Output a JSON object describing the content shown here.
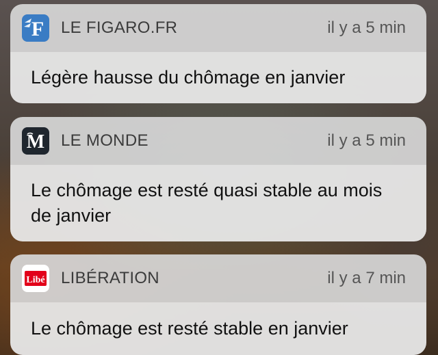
{
  "notifications": [
    {
      "app_name": "LE FIGARO.FR",
      "time": "il y a 5 min",
      "message": "Légère hausse du chômage en janvier",
      "icon": "le-figaro-logo-icon",
      "icon_color": "#3a7cc4",
      "icon_glyph": "F"
    },
    {
      "app_name": "LE MONDE",
      "time": "il y a 5 min",
      "message": "Le chômage est resté quasi stable au mois de janvier",
      "icon": "le-monde-logo-icon",
      "icon_color": "#1f262e",
      "icon_glyph": "M"
    },
    {
      "app_name": "LIBÉRATION",
      "time": "il y a 7 min",
      "message": "Le chômage est resté stable en janvier",
      "icon": "liberation-logo-icon",
      "icon_color": "#e2001a",
      "icon_glyph": "Libé"
    }
  ],
  "colors": {
    "header_bg": "#d6d6d6",
    "body_bg": "#e8e8e8",
    "liberation_red": "#e2001a"
  }
}
